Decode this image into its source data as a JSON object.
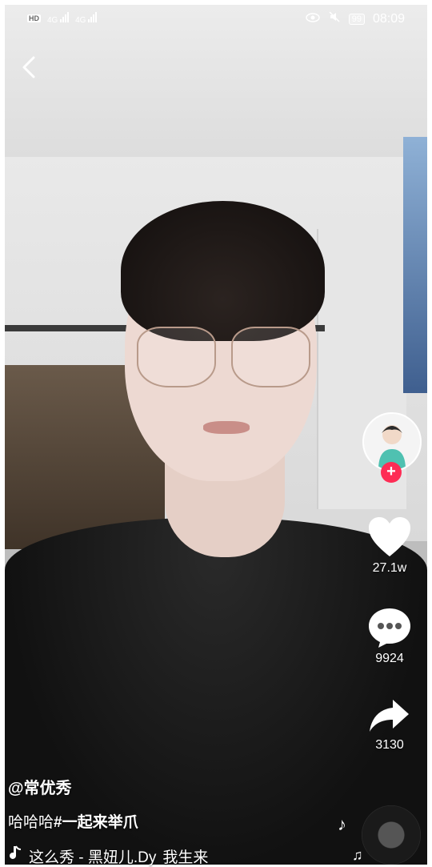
{
  "status_bar": {
    "left_badge": "HD",
    "signal1": "4G",
    "signal2": "4G",
    "battery": "99",
    "time": "08:09"
  },
  "post": {
    "author": "@常优秀",
    "caption_text": "哈哈哈",
    "caption_tag": "#一起来举爪",
    "music_parts": [
      "这么秀 - 黑妞儿.Dy",
      "我生来"
    ]
  },
  "actions": {
    "likes": "27.1w",
    "comments": "9924",
    "shares": "3130"
  },
  "colors": {
    "follow_plus": "#fe2c55",
    "text": "#ffffff"
  }
}
